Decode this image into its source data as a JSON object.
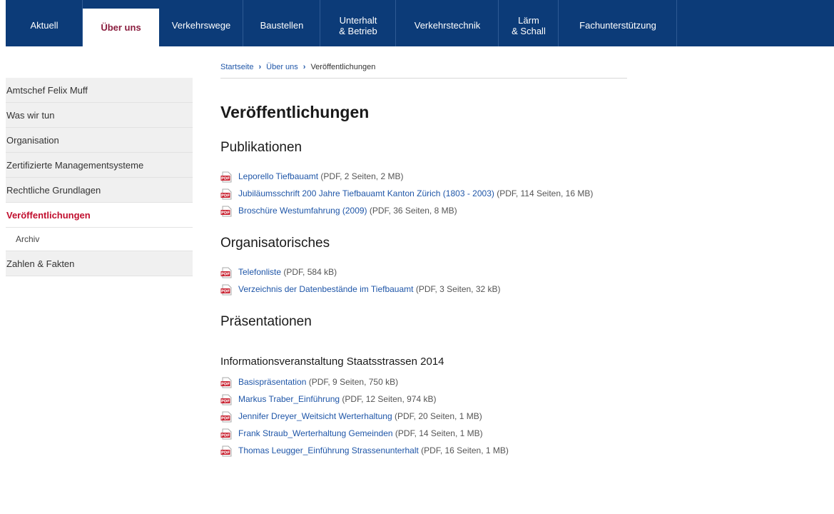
{
  "nav": {
    "tabs": [
      {
        "label": "Aktuell"
      },
      {
        "label": "Über uns"
      },
      {
        "label": "Verkehrswege"
      },
      {
        "label": "Baustellen"
      },
      {
        "label": "Unterhalt\n& Betrieb"
      },
      {
        "label": "Verkehrstechnik"
      },
      {
        "label": "Lärm\n& Schall"
      },
      {
        "label": "Fachunterstützung"
      }
    ]
  },
  "sidebar": {
    "items": [
      {
        "label": "Amtschef Felix Muff"
      },
      {
        "label": "Was wir tun"
      },
      {
        "label": "Organisation"
      },
      {
        "label": "Zertifizierte Managementsysteme"
      },
      {
        "label": "Rechtliche Grundlagen"
      },
      {
        "label": "Veröffentlichungen"
      },
      {
        "label": "Archiv"
      },
      {
        "label": "Zahlen & Fakten"
      }
    ]
  },
  "breadcrumb": {
    "home": "Startseite",
    "parent": "Über uns",
    "current": "Veröffentlichungen",
    "separator": "›"
  },
  "main": {
    "title": "Veröffentlichungen",
    "sections": [
      {
        "heading": "Publikationen",
        "docs": [
          {
            "link": "Leporello Tiefbauamt",
            "meta": " (PDF, 2 Seiten, 2 MB)"
          },
          {
            "link": "Jubiläumsschrift 200 Jahre Tiefbauamt Kanton Zürich (1803 - 2003)",
            "meta": " (PDF, 114 Seiten, 16 MB)"
          },
          {
            "link": "Broschüre Westumfahrung (2009)",
            "meta": " (PDF, 36 Seiten, 8 MB)"
          }
        ]
      },
      {
        "heading": "Organisatorisches",
        "docs": [
          {
            "link": "Telefonliste",
            "meta": " (PDF, 584 kB)"
          },
          {
            "link": "Verzeichnis der Datenbestände im Tiefbauamt",
            "meta": " (PDF, 3 Seiten, 32 kB)"
          }
        ]
      },
      {
        "heading": "Präsentationen",
        "subheading": "Informationsveranstaltung Staatsstrassen 2014",
        "docs": [
          {
            "link": "Basispräsentation",
            "meta": " (PDF, 9 Seiten, 750 kB)"
          },
          {
            "link": "Markus Traber_Einführung",
            "meta": " (PDF, 12 Seiten, 974 kB)"
          },
          {
            "link": "Jennifer Dreyer_Weitsicht Werterhaltung",
            "meta": " (PDF, 20 Seiten, 1 MB)"
          },
          {
            "link": "Frank Straub_Werterhaltung Gemeinden",
            "meta": " (PDF, 14 Seiten, 1 MB)"
          },
          {
            "link": "Thomas Leugger_Einführung Strassenunterhalt",
            "meta": " (PDF, 16 Seiten, 1 MB)"
          }
        ]
      }
    ]
  },
  "icons": {
    "pdf": "pdf-icon"
  },
  "colors": {
    "nav_bg": "#0c3b78",
    "active_tab_text": "#8b1e3f",
    "link": "#1f56a8",
    "sidebar_active": "#c10e2e",
    "pdf_red": "#c8202f"
  }
}
